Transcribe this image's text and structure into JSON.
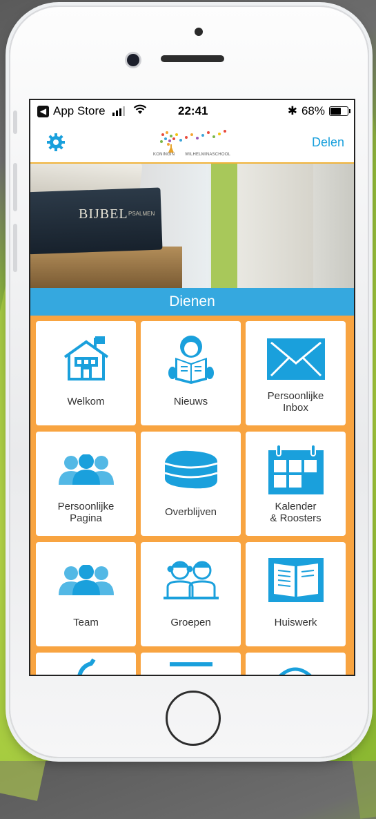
{
  "status_bar": {
    "back_app": "App Store",
    "time": "22:41",
    "bluetooth": "✱",
    "battery_percent": "68%",
    "battery_level": 0.68
  },
  "nav": {
    "action_label": "Delen",
    "logo_left": "KONINGIN",
    "logo_right": "WILHELMINASCHOOL"
  },
  "hero": {
    "book_title": "BIJBEL",
    "book_subtitle": "PSALMEN"
  },
  "section": {
    "title": "Dienen"
  },
  "tiles": [
    {
      "label": "Welkom",
      "icon": "school-house-icon"
    },
    {
      "label": "Nieuws",
      "icon": "reading-person-icon"
    },
    {
      "label": "Persoonlijke Inbox",
      "icon": "envelope-icon"
    },
    {
      "label": "Persoonlijke Pagina",
      "icon": "people-icon"
    },
    {
      "label": "Overblijven",
      "icon": "lunchbox-icon"
    },
    {
      "label": "Kalender & Roosters",
      "icon": "calendar-icon"
    },
    {
      "label": "Team",
      "icon": "people-icon"
    },
    {
      "label": "Groepen",
      "icon": "children-icon"
    },
    {
      "label": "Huiswerk",
      "icon": "open-book-icon"
    }
  ],
  "colors": {
    "accent_blue": "#1aa0dc",
    "section_blue": "#35a8df",
    "tile_border_orange": "#f8a441"
  }
}
